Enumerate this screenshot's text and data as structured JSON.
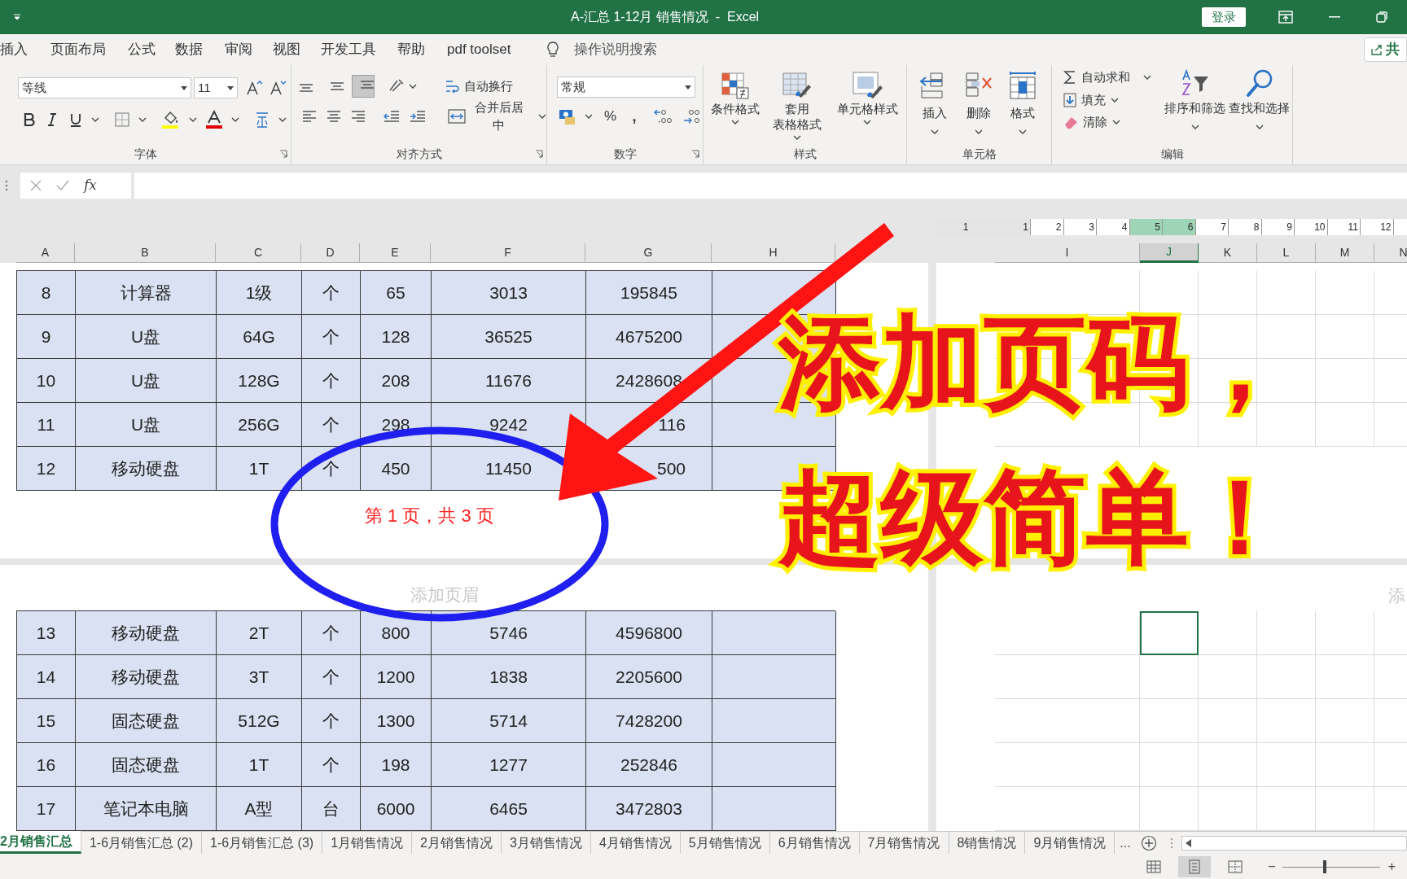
{
  "window": {
    "title": "A-汇总 1-12月 销售情况  -  Excel",
    "sign_in": "登录"
  },
  "menu": [
    "插入",
    "页面布局",
    "公式",
    "数据",
    "审阅",
    "视图",
    "开发工具",
    "帮助",
    "pdf toolset"
  ],
  "tell_me": "操作说明搜索",
  "share": "共",
  "ribbon": {
    "font": {
      "name": "等线",
      "size": "11",
      "label": "字体"
    },
    "alignment": {
      "wrap": "自动换行",
      "merge": "合并后居中",
      "label": "对齐方式",
      "vertical_align": [
        {
          "selected": false
        },
        {
          "selected": false
        },
        {
          "selected": true
        }
      ]
    },
    "number": {
      "format": "常规",
      "percent": "%",
      "comma": ",",
      "label": "数字"
    },
    "styles": {
      "buttons": [
        {
          "lines": [
            "条件格式"
          ]
        },
        {
          "lines": [
            "套用",
            "表格格式"
          ]
        },
        {
          "lines": [
            "单元格样式"
          ]
        }
      ],
      "label": "样式"
    },
    "cells": {
      "buttons": [
        "插入",
        "删除",
        "格式"
      ],
      "label": "单元格"
    },
    "editing": {
      "autosum": "自动求和",
      "fill": "填充",
      "clear": "清除",
      "sort": "排序和筛选",
      "find": "查找和选择",
      "label": "编辑"
    }
  },
  "formula_bar": {
    "fx": "fx"
  },
  "ruler": [
    "1",
    "1",
    "2",
    "3",
    "4",
    "5",
    "6",
    "7",
    "8",
    "9",
    "10",
    "11",
    "12"
  ],
  "left_columns": [
    "A",
    "B",
    "C",
    "D",
    "E",
    "F",
    "G",
    "H"
  ],
  "right_columns": [
    {
      "label": "I",
      "selected": false
    },
    {
      "label": "J",
      "selected": true
    },
    {
      "label": "K",
      "selected": false
    },
    {
      "label": "L",
      "selected": false
    },
    {
      "label": "M",
      "selected": false
    },
    {
      "label": "N",
      "selected": false
    }
  ],
  "top_rows": [
    [
      "8",
      "计算器",
      "1级",
      "个",
      "65",
      "3013",
      "195845"
    ],
    [
      "9",
      "U盘",
      "64G",
      "个",
      "128",
      "36525",
      "4675200"
    ],
    [
      "10",
      "U盘",
      "128G",
      "个",
      "208",
      "11676",
      "2428608"
    ],
    [
      "11",
      "U盘",
      "256G",
      "个",
      "298",
      "9242",
      {
        "text": "116",
        "covered": true
      }
    ],
    [
      "12",
      "移动硬盘",
      "1T",
      "个",
      "450",
      "11450",
      {
        "text": "500",
        "covered": true
      }
    ]
  ],
  "footer": "第 1 页，共 3 页",
  "header_hint": "添加页眉",
  "right_header_hint": "添",
  "bottom_rows": [
    [
      "13",
      "移动硬盘",
      "2T",
      "个",
      "800",
      "5746",
      "4596800"
    ],
    [
      "14",
      "移动硬盘",
      "3T",
      "个",
      "1200",
      "1838",
      "2205600"
    ],
    [
      "15",
      "固态硬盘",
      "512G",
      "个",
      "1300",
      "5714",
      "7428200"
    ],
    [
      "16",
      "固态硬盘",
      "1T",
      "个",
      "198",
      "1277",
      "252846"
    ],
    [
      "17",
      "笔记本电脑",
      "A型",
      "台",
      "6000",
      "6465",
      "3472803"
    ]
  ],
  "sheet_tabs": [
    {
      "label": "2月销售汇总",
      "selected": true
    },
    {
      "label": "1-6月销售汇总 (2)",
      "selected": false
    },
    {
      "label": "1-6月销售汇总 (3)",
      "selected": false
    },
    {
      "label": "1月销售情况",
      "selected": false
    },
    {
      "label": "2月销售情况",
      "selected": false
    },
    {
      "label": "3月销售情况",
      "selected": false
    },
    {
      "label": "4月销售情况",
      "selected": false
    },
    {
      "label": "5月销售情况",
      "selected": false
    },
    {
      "label": "6月销售情况",
      "selected": false
    },
    {
      "label": "7月销售情况",
      "selected": false
    },
    {
      "label": "8销售情况",
      "selected": false
    },
    {
      "label": "9月销售情况",
      "selected": false
    }
  ],
  "more_tabs": "...",
  "status": {
    "views": [
      {
        "selected": false
      },
      {
        "selected": true
      },
      {
        "selected": false
      }
    ],
    "zoom_out": "−",
    "zoom_in": "+",
    "zoom": {
      "level": 0.42
    }
  },
  "overlay": {
    "lines": [
      "添加页码，",
      "超级简单！"
    ]
  }
}
